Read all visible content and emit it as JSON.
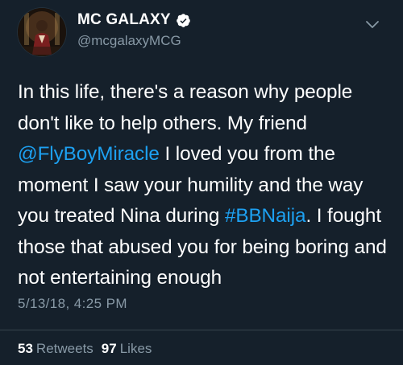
{
  "author": {
    "display_name": "MC GALAXY",
    "handle": "@mcgalaxyMCG",
    "verified": true
  },
  "tweet": {
    "text_part1": "In this life, there's a reason why people don't like to help others. My friend ",
    "mention": "@FlyBoyMiracle",
    "text_part2": " I loved you from the moment I saw your humility and the way you treated Nina during ",
    "hashtag": "#BBNaija",
    "text_part3": ". I fought those that abused you for being boring and not entertaining enough",
    "timestamp": "5/13/18, 4:25 PM"
  },
  "stats": {
    "retweets_count": "53",
    "retweets_label": "Retweets",
    "likes_count": "97",
    "likes_label": "Likes"
  },
  "colors": {
    "background": "#15202b",
    "link": "#1da1f2",
    "secondary_text": "#8899a6",
    "verified_badge": "#ffffff"
  },
  "icons": {
    "verified": "verified-badge-icon",
    "menu": "chevron-down-icon"
  }
}
